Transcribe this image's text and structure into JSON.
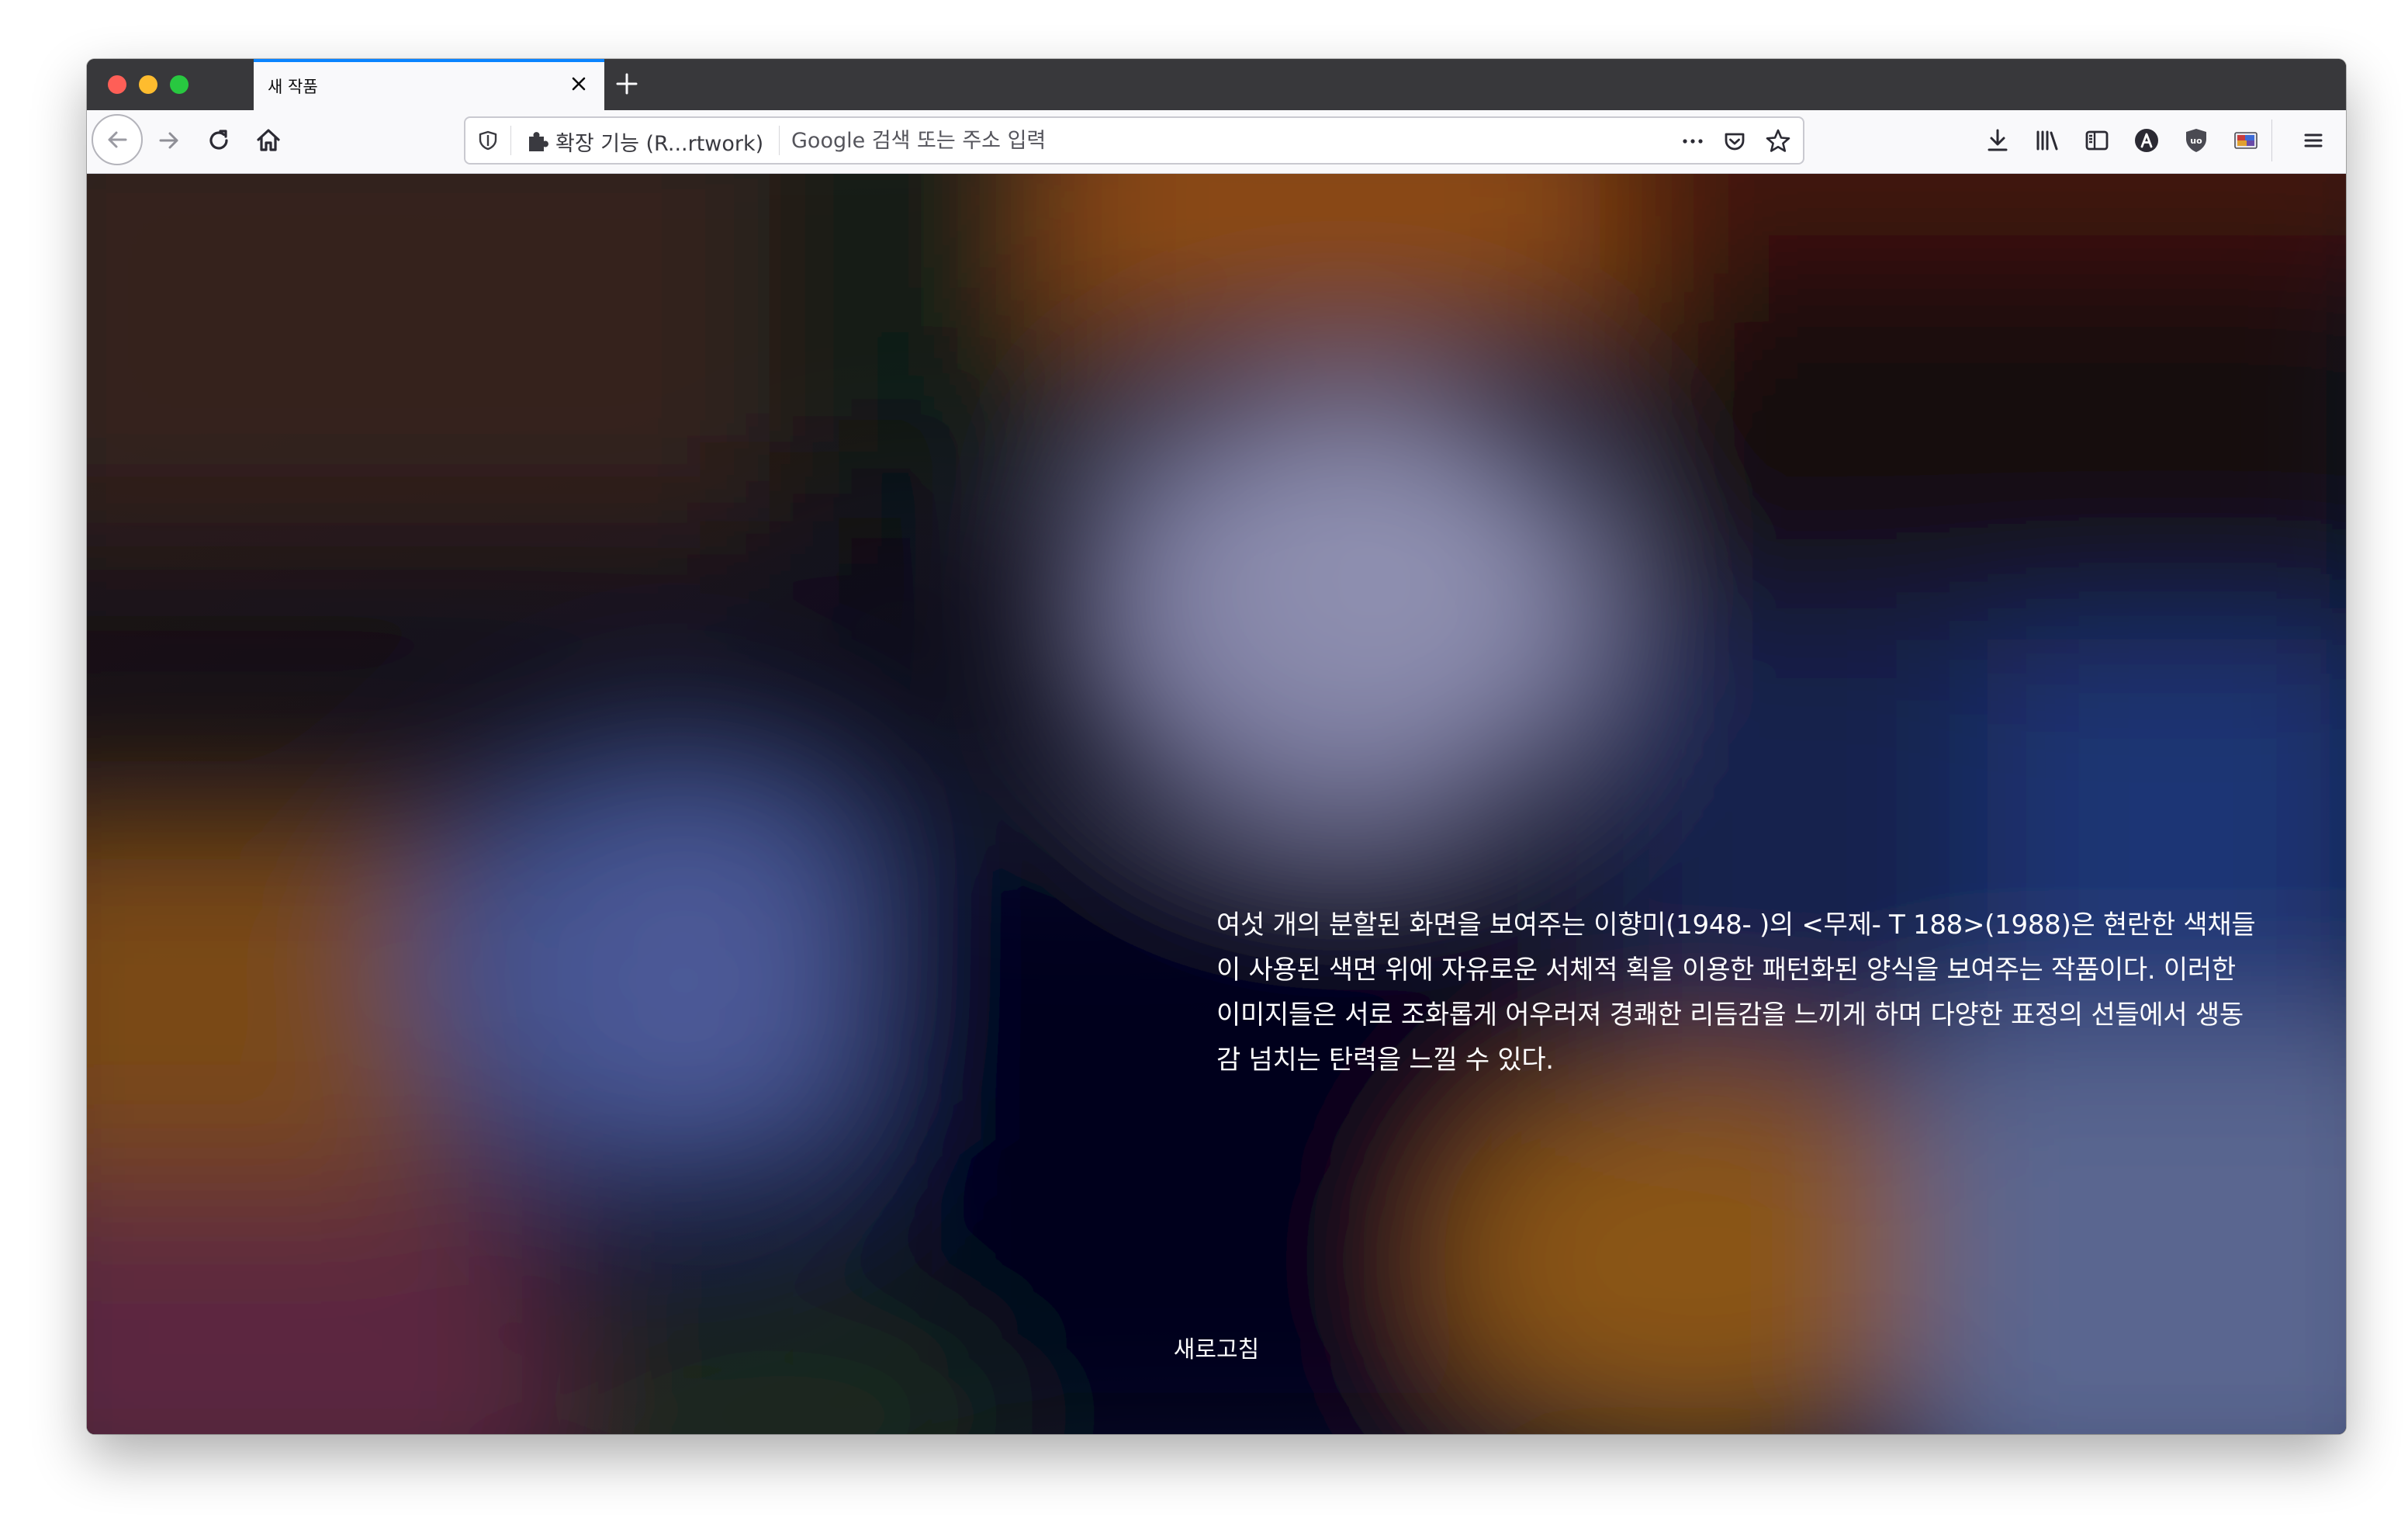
{
  "window": {
    "traffic_lights": [
      "close",
      "minimize",
      "maximize"
    ]
  },
  "tabs": [
    {
      "title": "새 작품",
      "active": true
    }
  ],
  "toolbar": {
    "icons": [
      "back-icon",
      "forward-icon",
      "reload-icon",
      "home-icon",
      "downloads-icon",
      "library-icon",
      "sidebar-icon",
      "account-icon",
      "ublock-icon",
      "extension-artwork-icon",
      "menu-icon"
    ]
  },
  "urlbar": {
    "identity_label": "확장 기능 (R...rtwork)",
    "placeholder": "Google 검색 또는 주소 입력",
    "value": ""
  },
  "content": {
    "description": "여섯 개의 분할된 화면을 보여주는 이향미(1948- )의 <무제- T 188>(1988)은 현란한 색채들이 사용된 색면 위에 자유로운 서체적 획을 이용한 패턴화된 양식을 보여주는 작품이다. 이러한 이미지들은 서로 조화롭게 어우러져 경쾌한 리듬감을 느끼게 하며 다양한 표정의 선들에서 생동감 넘치는 탄력을 느낄 수 있다.",
    "refresh_label": "새로고침"
  },
  "colors": {
    "accent": "#0a84ff",
    "tabstrip": "#38383b",
    "toolbar": "#f9f9fb"
  }
}
